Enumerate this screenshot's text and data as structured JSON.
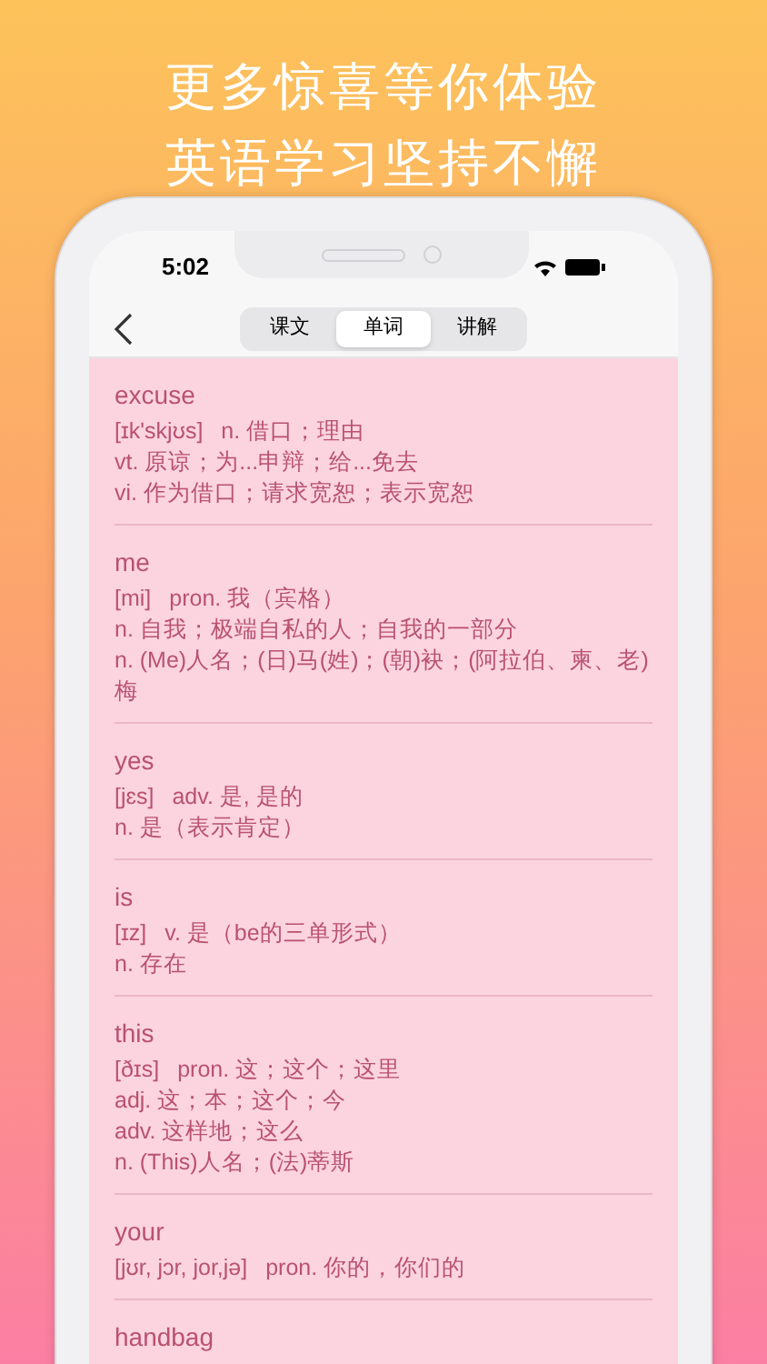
{
  "headline": [
    "更多惊喜等你体验",
    "英语学习坚持不懈"
  ],
  "status_bar": {
    "time": "5:02"
  },
  "tabs": [
    {
      "label": "课文",
      "selected": false
    },
    {
      "label": "单词",
      "selected": true
    },
    {
      "label": "讲解",
      "selected": false
    }
  ],
  "words": [
    {
      "word": "excuse",
      "phonetic": "[ɪk'skjʊs]",
      "meanings": [
        "n. 借口；理由",
        "vt. 原谅；为...申辩；给...免去",
        "vi. 作为借口；请求宽恕；表示宽恕"
      ]
    },
    {
      "word": "me",
      "phonetic": "[mi]",
      "meanings": [
        "pron. 我（宾格）",
        "n. 自我；极端自私的人；自我的一部分",
        "n. (Me)人名；(日)马(姓)；(朝)袂；(阿拉伯、柬、老)梅"
      ]
    },
    {
      "word": "yes",
      "phonetic": "[jɛs]",
      "meanings": [
        "adv. 是, 是的",
        "n. 是（表示肯定）"
      ]
    },
    {
      "word": "is",
      "phonetic": "[ɪz]",
      "meanings": [
        "v. 是（be的三单形式）",
        "n. 存在"
      ]
    },
    {
      "word": "this",
      "phonetic": "[ðɪs]",
      "meanings": [
        "pron. 这；这个；这里",
        "adj. 这；本；这个；今",
        "adv. 这样地；这么",
        "n. (This)人名；(法)蒂斯"
      ]
    },
    {
      "word": "your",
      "phonetic": "[jʊr, jɔr, jor,jə]",
      "meanings": [
        "pron. 你的，你们的"
      ]
    },
    {
      "word": "handbag"
    }
  ]
}
